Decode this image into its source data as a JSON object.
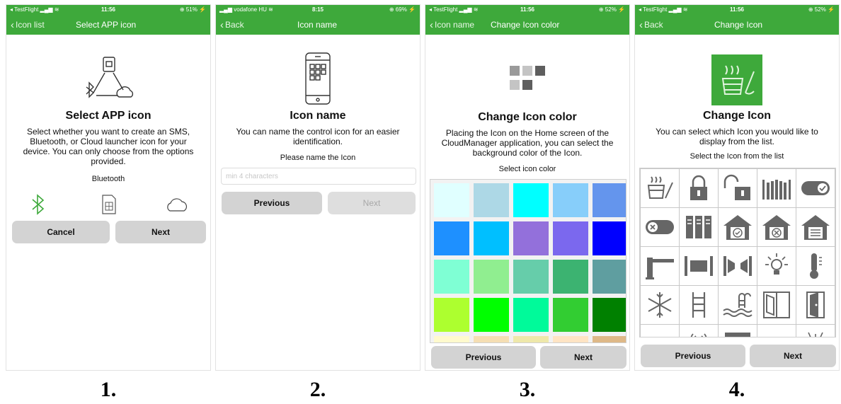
{
  "screens": [
    {
      "status": {
        "carrier": "◂ TestFlight ▂▄▆ ≋",
        "time": "11:56",
        "battery": "⊕ 51% ⚡"
      },
      "nav": {
        "back": "Icon list",
        "title": "Select APP icon"
      },
      "title": "Select APP icon",
      "description": "Select whether you want to create an SMS, Bluetooth, or Cloud launcher icon for your device. You can only choose from the options provided.",
      "selected_label": "Bluetooth",
      "choices": [
        {
          "icon": "bluetooth-icon"
        },
        {
          "icon": "sim-card-icon"
        },
        {
          "icon": "cloud-icon"
        }
      ],
      "buttons": {
        "cancel": "Cancel",
        "next": "Next"
      },
      "accent": "#3ea93b"
    },
    {
      "status": {
        "carrier": "▂▄▆ vodafone HU ≋",
        "time": "8:15",
        "battery": "⊕ 69% ⚡"
      },
      "nav": {
        "back": "Back",
        "title": "Icon name"
      },
      "title": "Icon name",
      "description": "You can name the control icon for an easier identification.",
      "field_label": "Please name the Icon",
      "field": {
        "value": "",
        "placeholder": "min 4 characters"
      },
      "buttons": {
        "previous": "Previous",
        "next": "Next"
      }
    },
    {
      "status": {
        "carrier": "◂ TestFlight ▂▄▆ ≋",
        "time": "11:56",
        "battery": "⊕ 52% ⚡"
      },
      "nav": {
        "back": "Icon name",
        "title": "Change Icon color"
      },
      "title": "Change Icon color",
      "description": "Placing the Icon on the Home screen of the CloudManager application, you can select the background color of the Icon.",
      "palette_label": "Select icon color",
      "colors": [
        "#e0ffff",
        "#add8e6",
        "#00ffff",
        "#87cefa",
        "#6495ed",
        "#1e90ff",
        "#00bfff",
        "#9370db",
        "#7b68ee",
        "#0000ff",
        "#7fffd4",
        "#90ee90",
        "#66cdaa",
        "#3cb371",
        "#5f9ea0",
        "#adff2f",
        "#00ff00",
        "#00fa9a",
        "#32cd32",
        "#008000",
        "#fffacd",
        "#f5deb3",
        "#eee8aa",
        "#ffe4c4",
        "#deb887"
      ],
      "buttons": {
        "previous": "Previous",
        "next": "Next"
      }
    },
    {
      "status": {
        "carrier": "◂ TestFlight ▂▄▆ ≋",
        "time": "11:56",
        "battery": "⊕ 52% ⚡"
      },
      "nav": {
        "back": "Back",
        "title": "Change Icon"
      },
      "title": "Change Icon",
      "description": "You can select which Icon you would like to display from the list.",
      "list_label": "Select the Icon from the list",
      "preview_color": "#3ea93b",
      "icons": [
        "sauna-bucket-icon",
        "padlock-closed-icon",
        "padlock-open-icon",
        "gate-icon",
        "toggle-on-icon",
        "toggle-off-icon",
        "cabinet-icon",
        "house-check-icon",
        "house-cross-icon",
        "garage-icon",
        "barrier-icon",
        "shutter-closed-icon",
        "shutter-open-icon",
        "lamp-icon",
        "thermometer-icon",
        "snowflake-icon",
        "ladder-icon",
        "pool-icon",
        "window-icon",
        "door-icon",
        "sofa-icon",
        "antenna-icon",
        "roller-blind-icon",
        "fan-icon",
        "sprinkler-icon"
      ],
      "buttons": {
        "previous": "Previous",
        "next": "Next"
      }
    }
  ],
  "steps": [
    "1.",
    "2.",
    "3.",
    "4."
  ]
}
